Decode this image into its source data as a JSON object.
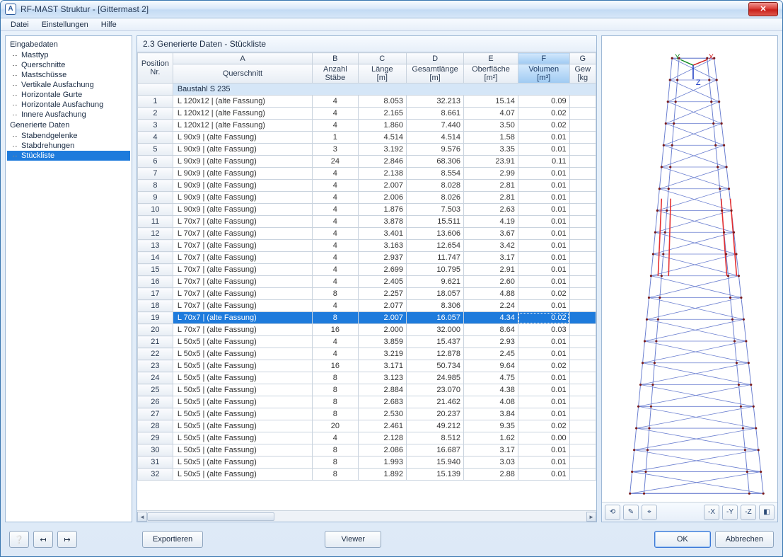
{
  "window": {
    "title": "RF-MAST Struktur - [Gittermast 2]"
  },
  "menu": {
    "items": [
      "Datei",
      "Einstellungen",
      "Hilfe"
    ]
  },
  "tree": {
    "groups": [
      {
        "label": "Eingabedaten",
        "items": [
          "Masttyp",
          "Querschnitte",
          "Mastschüsse",
          "Vertikale Ausfachung",
          "Horizontale Gurte",
          "Horizontale Ausfachung",
          "Innere Ausfachung"
        ]
      },
      {
        "label": "Generierte Daten",
        "items": [
          "Stabendgelenke",
          "Stabdrehungen",
          "Stückliste"
        ],
        "selected": "Stückliste"
      }
    ]
  },
  "panel": {
    "title": "2.3 Generierte Daten - Stückliste"
  },
  "grid": {
    "colLetters": [
      "A",
      "B",
      "C",
      "D",
      "E",
      "F",
      "G"
    ],
    "highlightCol": "F",
    "header1": {
      "pos": "Position\nNr."
    },
    "header2": [
      "Querschnitt",
      "Anzahl\nStäbe",
      "Länge\n[m]",
      "Gesamtlänge\n[m]",
      "Oberfläche\n[m²]",
      "Volumen\n[m³]",
      "Gew\n[kg"
    ],
    "sectionLabel": "Baustahl S 235",
    "selectedRow": 19,
    "rows": [
      {
        "n": 1,
        "qs": "L 120x12 | (alte Fassung)",
        "a": 4,
        "l": "8.053",
        "g": "32.213",
        "o": "15.14",
        "v": "0.09"
      },
      {
        "n": 2,
        "qs": "L 120x12 | (alte Fassung)",
        "a": 4,
        "l": "2.165",
        "g": "8.661",
        "o": "4.07",
        "v": "0.02"
      },
      {
        "n": 3,
        "qs": "L 120x12 | (alte Fassung)",
        "a": 4,
        "l": "1.860",
        "g": "7.440",
        "o": "3.50",
        "v": "0.02"
      },
      {
        "n": 4,
        "qs": "L 90x9 | (alte Fassung)",
        "a": 1,
        "l": "4.514",
        "g": "4.514",
        "o": "1.58",
        "v": "0.01"
      },
      {
        "n": 5,
        "qs": "L 90x9 | (alte Fassung)",
        "a": 3,
        "l": "3.192",
        "g": "9.576",
        "o": "3.35",
        "v": "0.01"
      },
      {
        "n": 6,
        "qs": "L 90x9 | (alte Fassung)",
        "a": 24,
        "l": "2.846",
        "g": "68.306",
        "o": "23.91",
        "v": "0.11"
      },
      {
        "n": 7,
        "qs": "L 90x9 | (alte Fassung)",
        "a": 4,
        "l": "2.138",
        "g": "8.554",
        "o": "2.99",
        "v": "0.01"
      },
      {
        "n": 8,
        "qs": "L 90x9 | (alte Fassung)",
        "a": 4,
        "l": "2.007",
        "g": "8.028",
        "o": "2.81",
        "v": "0.01"
      },
      {
        "n": 9,
        "qs": "L 90x9 | (alte Fassung)",
        "a": 4,
        "l": "2.006",
        "g": "8.026",
        "o": "2.81",
        "v": "0.01"
      },
      {
        "n": 10,
        "qs": "L 90x9 | (alte Fassung)",
        "a": 4,
        "l": "1.876",
        "g": "7.503",
        "o": "2.63",
        "v": "0.01"
      },
      {
        "n": 11,
        "qs": "L 70x7 | (alte Fassung)",
        "a": 4,
        "l": "3.878",
        "g": "15.511",
        "o": "4.19",
        "v": "0.01"
      },
      {
        "n": 12,
        "qs": "L 70x7 | (alte Fassung)",
        "a": 4,
        "l": "3.401",
        "g": "13.606",
        "o": "3.67",
        "v": "0.01"
      },
      {
        "n": 13,
        "qs": "L 70x7 | (alte Fassung)",
        "a": 4,
        "l": "3.163",
        "g": "12.654",
        "o": "3.42",
        "v": "0.01"
      },
      {
        "n": 14,
        "qs": "L 70x7 | (alte Fassung)",
        "a": 4,
        "l": "2.937",
        "g": "11.747",
        "o": "3.17",
        "v": "0.01"
      },
      {
        "n": 15,
        "qs": "L 70x7 | (alte Fassung)",
        "a": 4,
        "l": "2.699",
        "g": "10.795",
        "o": "2.91",
        "v": "0.01"
      },
      {
        "n": 16,
        "qs": "L 70x7 | (alte Fassung)",
        "a": 4,
        "l": "2.405",
        "g": "9.621",
        "o": "2.60",
        "v": "0.01"
      },
      {
        "n": 17,
        "qs": "L 70x7 | (alte Fassung)",
        "a": 8,
        "l": "2.257",
        "g": "18.057",
        "o": "4.88",
        "v": "0.02"
      },
      {
        "n": 18,
        "qs": "L 70x7 | (alte Fassung)",
        "a": 4,
        "l": "2.077",
        "g": "8.306",
        "o": "2.24",
        "v": "0.01"
      },
      {
        "n": 19,
        "qs": "L 70x7 | (alte Fassung)",
        "a": 8,
        "l": "2.007",
        "g": "16.057",
        "o": "4.34",
        "v": "0.02"
      },
      {
        "n": 20,
        "qs": "L 70x7 | (alte Fassung)",
        "a": 16,
        "l": "2.000",
        "g": "32.000",
        "o": "8.64",
        "v": "0.03"
      },
      {
        "n": 21,
        "qs": "L 50x5 | (alte Fassung)",
        "a": 4,
        "l": "3.859",
        "g": "15.437",
        "o": "2.93",
        "v": "0.01"
      },
      {
        "n": 22,
        "qs": "L 50x5 | (alte Fassung)",
        "a": 4,
        "l": "3.219",
        "g": "12.878",
        "o": "2.45",
        "v": "0.01"
      },
      {
        "n": 23,
        "qs": "L 50x5 | (alte Fassung)",
        "a": 16,
        "l": "3.171",
        "g": "50.734",
        "o": "9.64",
        "v": "0.02"
      },
      {
        "n": 24,
        "qs": "L 50x5 | (alte Fassung)",
        "a": 8,
        "l": "3.123",
        "g": "24.985",
        "o": "4.75",
        "v": "0.01"
      },
      {
        "n": 25,
        "qs": "L 50x5 | (alte Fassung)",
        "a": 8,
        "l": "2.884",
        "g": "23.070",
        "o": "4.38",
        "v": "0.01"
      },
      {
        "n": 26,
        "qs": "L 50x5 | (alte Fassung)",
        "a": 8,
        "l": "2.683",
        "g": "21.462",
        "o": "4.08",
        "v": "0.01"
      },
      {
        "n": 27,
        "qs": "L 50x5 | (alte Fassung)",
        "a": 8,
        "l": "2.530",
        "g": "20.237",
        "o": "3.84",
        "v": "0.01"
      },
      {
        "n": 28,
        "qs": "L 50x5 | (alte Fassung)",
        "a": 20,
        "l": "2.461",
        "g": "49.212",
        "o": "9.35",
        "v": "0.02"
      },
      {
        "n": 29,
        "qs": "L 50x5 | (alte Fassung)",
        "a": 4,
        "l": "2.128",
        "g": "8.512",
        "o": "1.62",
        "v": "0.00"
      },
      {
        "n": 30,
        "qs": "L 50x5 | (alte Fassung)",
        "a": 8,
        "l": "2.086",
        "g": "16.687",
        "o": "3.17",
        "v": "0.01"
      },
      {
        "n": 31,
        "qs": "L 50x5 | (alte Fassung)",
        "a": 8,
        "l": "1.993",
        "g": "15.940",
        "o": "3.03",
        "v": "0.01"
      },
      {
        "n": 32,
        "qs": "L 50x5 | (alte Fassung)",
        "a": 8,
        "l": "1.892",
        "g": "15.139",
        "o": "2.88",
        "v": "0.01"
      }
    ]
  },
  "footer": {
    "export": "Exportieren",
    "viewer": "Viewer",
    "ok": "OK",
    "cancel": "Abbrechen"
  },
  "previewToolbar": {
    "b1": "⟲",
    "b2": "✎",
    "b3": "⌖",
    "bx": "-X",
    "by": "-Y",
    "bz": "-Z",
    "iso": "◧"
  }
}
